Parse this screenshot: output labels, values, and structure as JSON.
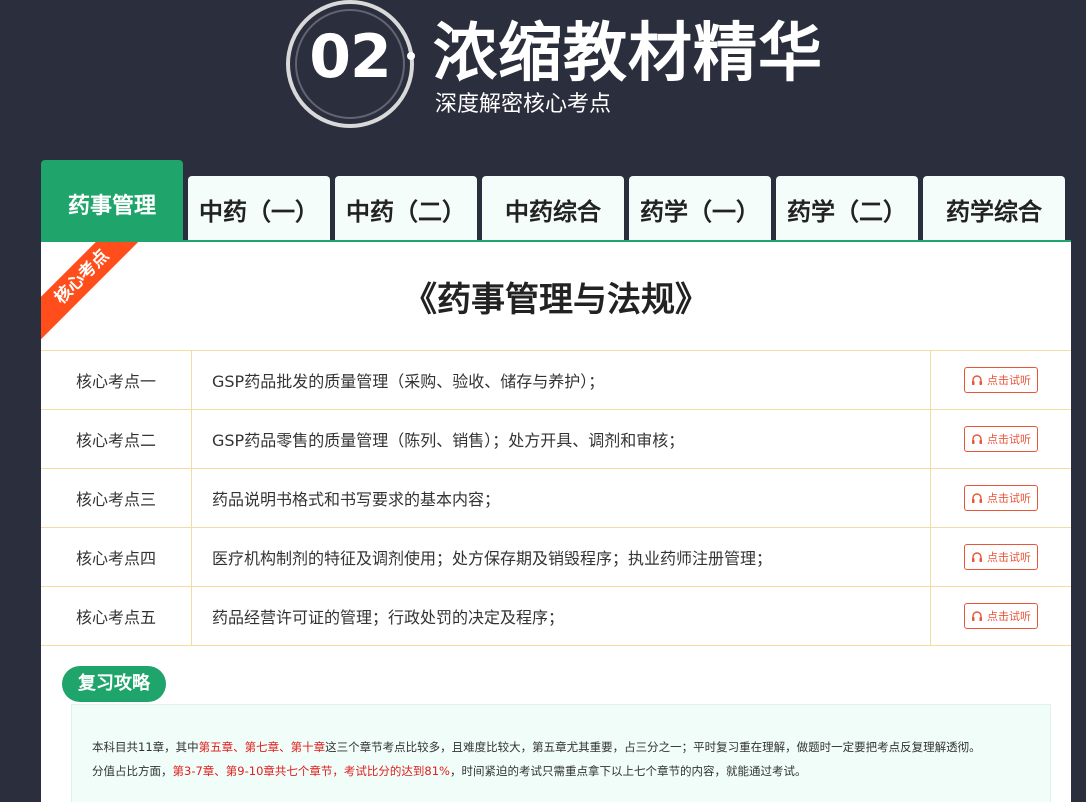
{
  "hero": {
    "number": "02",
    "title": "浓缩教材精华",
    "subtitle": "深度解密核心考点"
  },
  "tabs": [
    {
      "label": "药事管理",
      "active": true
    },
    {
      "label": "中药（一）",
      "active": false
    },
    {
      "label": "中药（二）",
      "active": false
    },
    {
      "label": "中药综合",
      "active": false
    },
    {
      "label": "药学（一）",
      "active": false
    },
    {
      "label": "药学（二）",
      "active": false
    },
    {
      "label": "药学综合",
      "active": false
    }
  ],
  "panel": {
    "ribbon": "核心考点",
    "title": "《药事管理与法规》",
    "listen_label": "点击试听",
    "points": [
      {
        "label": "核心考点一",
        "desc": "GSP药品批发的质量管理（采购、验收、储存与养护）；"
      },
      {
        "label": "核心考点二",
        "desc": "GSP药品零售的质量管理（陈列、销售）；处方开具、调剂和审核；"
      },
      {
        "label": "核心考点三",
        "desc": "药品说明书格式和书写要求的基本内容；"
      },
      {
        "label": "核心考点四",
        "desc": "医疗机构制剂的特征及调剂使用；处方保存期及销毁程序；执业药师注册管理；"
      },
      {
        "label": "核心考点五",
        "desc": "药品经营许可证的管理；行政处罚的决定及程序；"
      }
    ]
  },
  "review": {
    "tag": "复习攻略",
    "line1_a": "本科目共11章，其中",
    "line1_red": "第五章、第七章、第十章",
    "line1_b": "这三个章节考点比较多，且难度比较大，第五章尤其重要，占三分之一；平时复习重在理解，做题时一定要把考点反复理解透彻。",
    "line2_a": "分值占比方面，",
    "line2_red": "第3-7章、第9-10章共七个章节，考试比分的达到81%",
    "line2_b": "，时间紧迫的考试只需重点拿下以上七个章节的内容，就能通过考试。"
  },
  "colors": {
    "background": "#2b2e3c",
    "accent": "#1fa46b",
    "ribbon": "#ff4e1b",
    "highlight": "#e02020"
  }
}
